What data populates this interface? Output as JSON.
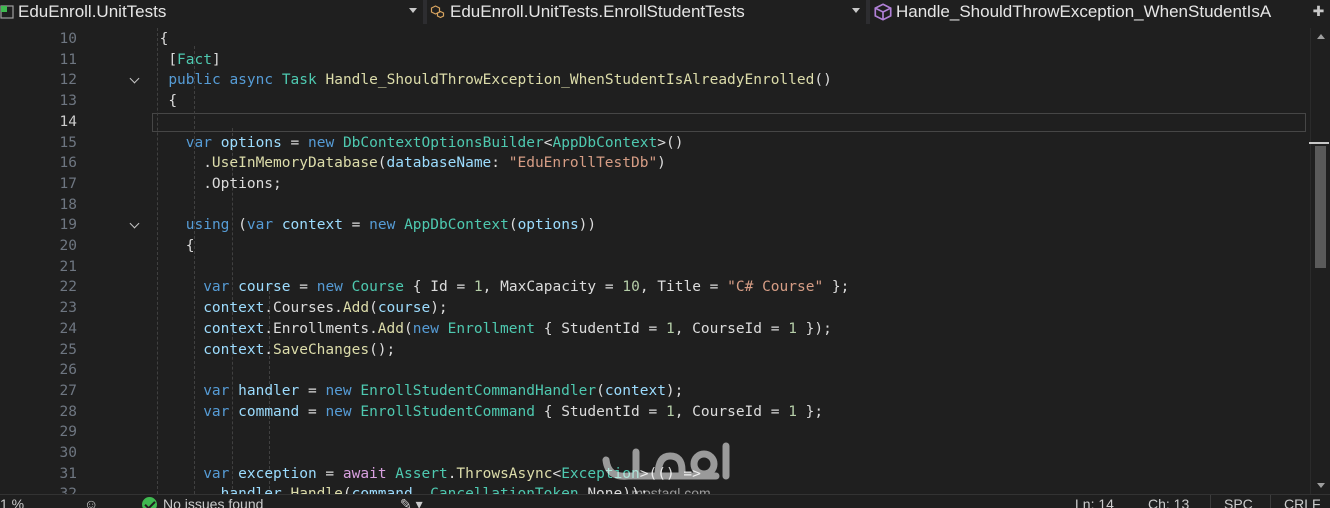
{
  "navbar": {
    "project": "EduEnroll.UnitTests",
    "class": "EduEnroll.UnitTests.EnrollStudentTests",
    "member": "Handle_ShouldThrowException_WhenStudentIsA"
  },
  "editor": {
    "current_line": "14",
    "lines": [
      {
        "n": "10",
        "parts": [
          {
            "t": "{",
            "c": "pl"
          }
        ]
      },
      {
        "n": "11",
        "parts": [
          {
            "t": "[",
            "c": "pl"
          },
          {
            "t": "Fact",
            "c": "ty"
          },
          {
            "t": "]",
            "c": "pl"
          }
        ]
      },
      {
        "n": "12",
        "parts": [
          {
            "t": "public",
            "c": "kw"
          },
          {
            "t": " ",
            "c": "pl"
          },
          {
            "t": "async",
            "c": "kw"
          },
          {
            "t": " ",
            "c": "pl"
          },
          {
            "t": "Task",
            "c": "ty"
          },
          {
            "t": " ",
            "c": "pl"
          },
          {
            "t": "Handle_ShouldThrowException_WhenStudentIsAlreadyEnrolled",
            "c": "fn"
          },
          {
            "t": "()",
            "c": "pl"
          }
        ]
      },
      {
        "n": "13",
        "parts": [
          {
            "t": "{",
            "c": "pl"
          }
        ]
      },
      {
        "n": "14",
        "parts": []
      },
      {
        "n": "15",
        "parts": [
          {
            "t": "var",
            "c": "kw"
          },
          {
            "t": " ",
            "c": "pl"
          },
          {
            "t": "options",
            "c": "vr"
          },
          {
            "t": " = ",
            "c": "pl"
          },
          {
            "t": "new",
            "c": "kw"
          },
          {
            "t": " ",
            "c": "pl"
          },
          {
            "t": "DbContextOptionsBuilder",
            "c": "ty"
          },
          {
            "t": "<",
            "c": "pl"
          },
          {
            "t": "AppDbContext",
            "c": "ty"
          },
          {
            "t": ">()",
            "c": "pl"
          }
        ]
      },
      {
        "n": "16",
        "parts": [
          {
            "t": ".",
            "c": "pl"
          },
          {
            "t": "UseInMemoryDatabase",
            "c": "fn"
          },
          {
            "t": "(",
            "c": "pl"
          },
          {
            "t": "databaseName",
            "c": "vr"
          },
          {
            "t": ": ",
            "c": "pl"
          },
          {
            "t": "\"EduEnrollTestDb\"",
            "c": "st"
          },
          {
            "t": ")",
            "c": "pl"
          }
        ]
      },
      {
        "n": "17",
        "parts": [
          {
            "t": ".",
            "c": "pl"
          },
          {
            "t": "Options",
            "c": "pl"
          },
          {
            "t": ";",
            "c": "pl"
          }
        ]
      },
      {
        "n": "18",
        "parts": []
      },
      {
        "n": "19",
        "parts": [
          {
            "t": "using",
            "c": "kw"
          },
          {
            "t": " (",
            "c": "pl"
          },
          {
            "t": "var",
            "c": "kw"
          },
          {
            "t": " ",
            "c": "pl"
          },
          {
            "t": "context",
            "c": "vr"
          },
          {
            "t": " = ",
            "c": "pl"
          },
          {
            "t": "new",
            "c": "kw"
          },
          {
            "t": " ",
            "c": "pl"
          },
          {
            "t": "AppDbContext",
            "c": "ty"
          },
          {
            "t": "(",
            "c": "pl"
          },
          {
            "t": "options",
            "c": "vr"
          },
          {
            "t": "))",
            "c": "pl"
          }
        ]
      },
      {
        "n": "20",
        "parts": [
          {
            "t": "{",
            "c": "pl"
          }
        ]
      },
      {
        "n": "21",
        "parts": []
      },
      {
        "n": "22",
        "parts": [
          {
            "t": "var",
            "c": "kw"
          },
          {
            "t": " ",
            "c": "pl"
          },
          {
            "t": "course",
            "c": "vr"
          },
          {
            "t": " = ",
            "c": "pl"
          },
          {
            "t": "new",
            "c": "kw"
          },
          {
            "t": " ",
            "c": "pl"
          },
          {
            "t": "Course",
            "c": "ty"
          },
          {
            "t": " { ",
            "c": "pl"
          },
          {
            "t": "Id",
            "c": "pl"
          },
          {
            "t": " = ",
            "c": "pl"
          },
          {
            "t": "1",
            "c": "nm"
          },
          {
            "t": ", ",
            "c": "pl"
          },
          {
            "t": "MaxCapacity",
            "c": "pl"
          },
          {
            "t": " = ",
            "c": "pl"
          },
          {
            "t": "10",
            "c": "nm"
          },
          {
            "t": ", ",
            "c": "pl"
          },
          {
            "t": "Title",
            "c": "pl"
          },
          {
            "t": " = ",
            "c": "pl"
          },
          {
            "t": "\"C# Course\"",
            "c": "st"
          },
          {
            "t": " };",
            "c": "pl"
          }
        ]
      },
      {
        "n": "23",
        "parts": [
          {
            "t": "context",
            "c": "vr"
          },
          {
            "t": ".",
            "c": "pl"
          },
          {
            "t": "Courses",
            "c": "pl"
          },
          {
            "t": ".",
            "c": "pl"
          },
          {
            "t": "Add",
            "c": "fn"
          },
          {
            "t": "(",
            "c": "pl"
          },
          {
            "t": "course",
            "c": "vr"
          },
          {
            "t": ");",
            "c": "pl"
          }
        ]
      },
      {
        "n": "24",
        "parts": [
          {
            "t": "context",
            "c": "vr"
          },
          {
            "t": ".",
            "c": "pl"
          },
          {
            "t": "Enrollments",
            "c": "pl"
          },
          {
            "t": ".",
            "c": "pl"
          },
          {
            "t": "Add",
            "c": "fn"
          },
          {
            "t": "(",
            "c": "pl"
          },
          {
            "t": "new",
            "c": "kw"
          },
          {
            "t": " ",
            "c": "pl"
          },
          {
            "t": "Enrollment",
            "c": "ty"
          },
          {
            "t": " { ",
            "c": "pl"
          },
          {
            "t": "StudentId",
            "c": "pl"
          },
          {
            "t": " = ",
            "c": "pl"
          },
          {
            "t": "1",
            "c": "nm"
          },
          {
            "t": ", ",
            "c": "pl"
          },
          {
            "t": "CourseId",
            "c": "pl"
          },
          {
            "t": " = ",
            "c": "pl"
          },
          {
            "t": "1",
            "c": "nm"
          },
          {
            "t": " });",
            "c": "pl"
          }
        ]
      },
      {
        "n": "25",
        "parts": [
          {
            "t": "context",
            "c": "vr"
          },
          {
            "t": ".",
            "c": "pl"
          },
          {
            "t": "SaveChanges",
            "c": "fn"
          },
          {
            "t": "();",
            "c": "pl"
          }
        ]
      },
      {
        "n": "26",
        "parts": []
      },
      {
        "n": "27",
        "parts": [
          {
            "t": "var",
            "c": "kw"
          },
          {
            "t": " ",
            "c": "pl"
          },
          {
            "t": "handler",
            "c": "vr"
          },
          {
            "t": " = ",
            "c": "pl"
          },
          {
            "t": "new",
            "c": "kw"
          },
          {
            "t": " ",
            "c": "pl"
          },
          {
            "t": "EnrollStudentCommandHandler",
            "c": "ty"
          },
          {
            "t": "(",
            "c": "pl"
          },
          {
            "t": "context",
            "c": "vr"
          },
          {
            "t": ");",
            "c": "pl"
          }
        ]
      },
      {
        "n": "28",
        "parts": [
          {
            "t": "var",
            "c": "kw"
          },
          {
            "t": " ",
            "c": "pl"
          },
          {
            "t": "command",
            "c": "vr"
          },
          {
            "t": " = ",
            "c": "pl"
          },
          {
            "t": "new",
            "c": "kw"
          },
          {
            "t": " ",
            "c": "pl"
          },
          {
            "t": "EnrollStudentCommand",
            "c": "ty"
          },
          {
            "t": " { ",
            "c": "pl"
          },
          {
            "t": "StudentId",
            "c": "pl"
          },
          {
            "t": " = ",
            "c": "pl"
          },
          {
            "t": "1",
            "c": "nm"
          },
          {
            "t": ", ",
            "c": "pl"
          },
          {
            "t": "CourseId",
            "c": "pl"
          },
          {
            "t": " = ",
            "c": "pl"
          },
          {
            "t": "1",
            "c": "nm"
          },
          {
            "t": " };",
            "c": "pl"
          }
        ]
      },
      {
        "n": "29",
        "parts": []
      },
      {
        "n": "30",
        "parts": []
      },
      {
        "n": "31",
        "parts": [
          {
            "t": "var",
            "c": "kw"
          },
          {
            "t": " ",
            "c": "pl"
          },
          {
            "t": "exception",
            "c": "vr"
          },
          {
            "t": " = ",
            "c": "pl"
          },
          {
            "t": "await",
            "c": "ak"
          },
          {
            "t": " ",
            "c": "pl"
          },
          {
            "t": "Assert",
            "c": "ty"
          },
          {
            "t": ".",
            "c": "pl"
          },
          {
            "t": "ThrowsAsync",
            "c": "fn"
          },
          {
            "t": "<",
            "c": "pl"
          },
          {
            "t": "Exception",
            "c": "ty"
          },
          {
            "t": ">(() =>",
            "c": "pl"
          }
        ]
      },
      {
        "n": "32",
        "parts": [
          {
            "t": "handler",
            "c": "vr"
          },
          {
            "t": ".",
            "c": "pl"
          },
          {
            "t": "Handle",
            "c": "fn"
          },
          {
            "t": "(",
            "c": "pl"
          },
          {
            "t": "command",
            "c": "vr"
          },
          {
            "t": ", ",
            "c": "pl"
          },
          {
            "t": "CancellationToken",
            "c": "ty"
          },
          {
            "t": ".",
            "c": "pl"
          },
          {
            "t": "None",
            "c": "pl"
          },
          {
            "t": "));",
            "c": "pl"
          }
        ]
      }
    ]
  },
  "statusbar": {
    "zoom": "1 %",
    "issues": "No issues found",
    "line": "Ln: 14",
    "col": "Ch: 13",
    "encoding": "SPC",
    "eol": "CRLF"
  },
  "colors": {
    "background": "#1f1f1f",
    "keyword": "#569cd6",
    "type": "#4ec9b0",
    "method": "#dcdcaa",
    "variable": "#9cdcfe",
    "string": "#d69d85",
    "number": "#b5cea8",
    "control_keyword": "#d8a0df",
    "ok_icon": "#3fb950"
  },
  "icons": {
    "project": "csharp-project-icon",
    "class": "class-icon",
    "member": "method-cube-icon",
    "split": "split-editor-icon",
    "fold": "chevron-down-icon",
    "issues": "check-circle-icon",
    "cleanup": "brush-icon"
  }
}
